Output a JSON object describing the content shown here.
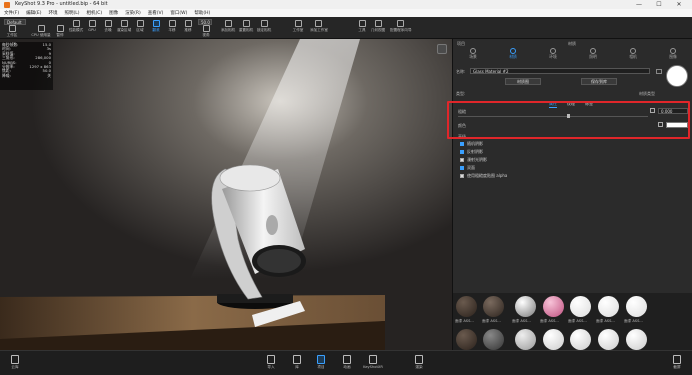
{
  "window": {
    "title": "KeyShot 9.3 Pro - untitled.bip - 64 bit",
    "min": "—",
    "max": "☐",
    "close": "✕"
  },
  "menu": [
    "文件(F)",
    "编辑(E)",
    "环境",
    "照明(L)",
    "相机(C)",
    "图像",
    "渲染(R)",
    "查看(V)",
    "窗口(W)",
    "帮助(H)"
  ],
  "toolbar": {
    "workspace": "Default",
    "items": [
      {
        "label": "工作区"
      },
      {
        "label": "CPU 使用量"
      },
      {
        "label": "暂停"
      },
      {
        "label": "性能模式"
      },
      {
        "label": "GPU"
      },
      {
        "label": "去噪"
      },
      {
        "label": "渲染区域"
      },
      {
        "label": "区域"
      },
      {
        "label": "翻滚"
      },
      {
        "label": "平移"
      },
      {
        "label": "推移"
      },
      {
        "label": "视角"
      },
      {
        "label": "添加相机"
      },
      {
        "label": "重置相机"
      },
      {
        "label": "锁定相机"
      },
      {
        "label": "工作室"
      },
      {
        "label": "添加工作室"
      },
      {
        "label": "工具"
      },
      {
        "label": "几何视图"
      },
      {
        "label": "配置程序向导"
      }
    ],
    "zoom": "50.0",
    "active": "翻滚"
  },
  "stats": [
    {
      "k": "每秒帧数:",
      "v": "15.0"
    },
    {
      "k": "时间:",
      "v": "3s"
    },
    {
      "k": "采样值:",
      "v": "9"
    },
    {
      "k": "三角形:",
      "v": "286,000"
    },
    {
      "k": "NURBS:",
      "v": "0"
    },
    {
      "k": "分辨率:",
      "v": "1297 x 863"
    },
    {
      "k": "焦距:",
      "v": "50.0"
    },
    {
      "k": "降噪:",
      "v": "关"
    }
  ],
  "panel": {
    "header_left": "项目",
    "header_center": "材质",
    "tabs": [
      {
        "label": "场景"
      },
      {
        "label": "材质"
      },
      {
        "label": "环境"
      },
      {
        "label": "照明"
      },
      {
        "label": "相机"
      },
      {
        "label": "图像"
      }
    ],
    "name_label": "名称:",
    "name_value": "Glass Material #2",
    "btn_graph": "材质图",
    "btn_save": "保存到库",
    "type_label": "类型:",
    "type_right": "材质类型",
    "subtabs": [
      "属性",
      "纹理",
      "标签"
    ],
    "roughness_label": "粗糙",
    "roughness_value": "0.000",
    "color_label": "颜色",
    "advanced_label": "高级",
    "checkboxes": [
      {
        "label": "随机阴影",
        "on": true
      },
      {
        "label": "反射阴影",
        "on": true
      },
      {
        "label": "漫射光阴影",
        "on": false
      },
      {
        "label": "双面",
        "on": true
      },
      {
        "label": "使用粗糙度贴图 alpha",
        "on": false
      }
    ]
  },
  "library": {
    "items": [
      {
        "label": "面漆 ASS..."
      },
      {
        "label": "面漆 ASS..."
      },
      {
        "label": "面漆 ASS..."
      },
      {
        "label": "面漆 ASS..."
      },
      {
        "label": "面漆 ASS..."
      },
      {
        "label": "面漆 ASS..."
      },
      {
        "label": "面漆 ASS..."
      }
    ]
  },
  "bottombar": {
    "items": [
      {
        "label": "导入"
      },
      {
        "label": "库"
      },
      {
        "label": "项目"
      },
      {
        "label": "动画"
      },
      {
        "label": "KeyShotXR"
      },
      {
        "label": "渲染"
      }
    ],
    "active": "项目",
    "left": "云库",
    "right": "截屏"
  }
}
